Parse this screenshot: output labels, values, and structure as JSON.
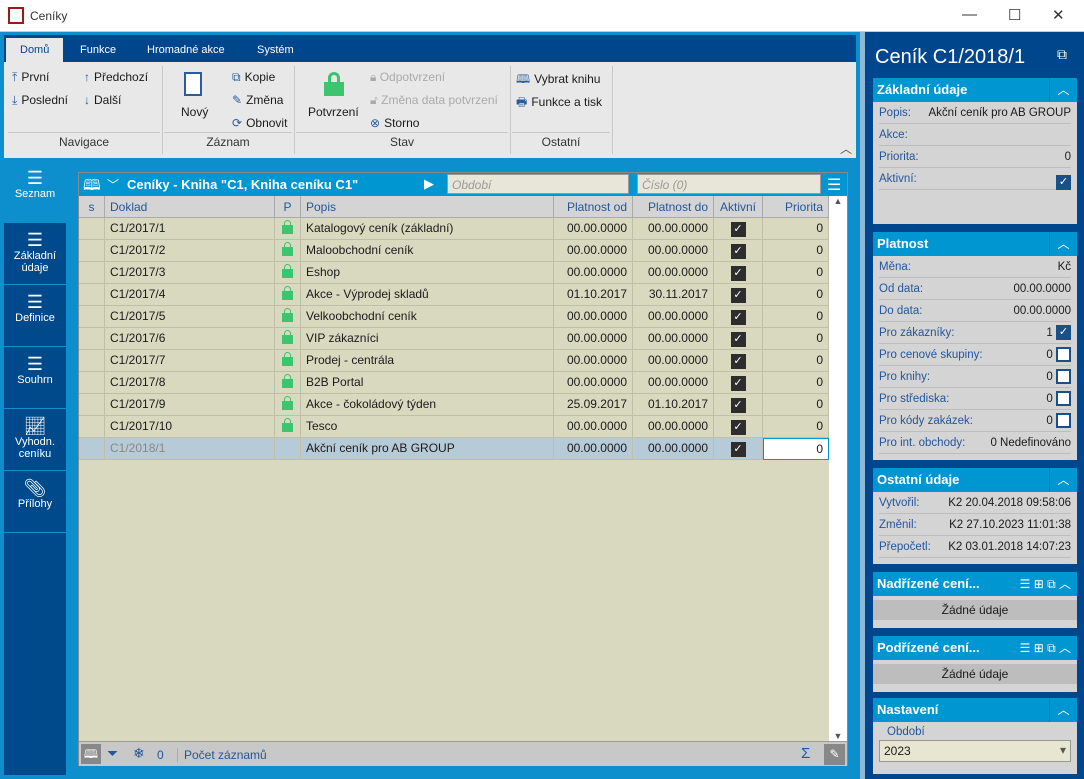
{
  "window": {
    "title": "Ceníky",
    "minimize": "—",
    "maximize": "☐",
    "close": "✕"
  },
  "ribbon": {
    "tabs": [
      "Domů",
      "Funkce",
      "Hromadné akce",
      "Systém"
    ],
    "nav": {
      "first": "První",
      "prev": "Předchozí",
      "last": "Poslední",
      "next": "Další",
      "group": "Navigace"
    },
    "record": {
      "new": "Nový",
      "copy": "Kopie",
      "change": "Změna",
      "refresh": "Obnovit",
      "group": "Záznam"
    },
    "state": {
      "confirm": "Potvrzení",
      "unconfirm": "Odpotvrzení",
      "change_date": "Změna data potvrzení",
      "cancel": "Storno",
      "group": "Stav"
    },
    "other": {
      "book": "Vybrat knihu",
      "print": "Funkce a tisk",
      "group": "Ostatní"
    }
  },
  "sidebar": [
    {
      "label": "Seznam",
      "icon": "list-icon"
    },
    {
      "label": "Základní údaje",
      "icon": "list-icon"
    },
    {
      "label": "Definice",
      "icon": "list-icon"
    },
    {
      "label": "Souhrn",
      "icon": "list-icon"
    },
    {
      "label": "Vyhodn. ceníku",
      "icon": "chart-icon"
    },
    {
      "label": "Přílohy",
      "icon": "paperclip-icon"
    }
  ],
  "grid": {
    "title": "Ceníky - Kniha \"C1, Kniha ceníku C1\"",
    "period_placeholder": "Období",
    "number_placeholder": "Číslo (0)",
    "columns": [
      "s",
      "Doklad",
      "P",
      "Popis",
      "Platnost od",
      "Platnost do",
      "Aktivní",
      "Priorita"
    ],
    "rows": [
      {
        "doklad": "C1/2017/1",
        "locked": true,
        "popis": "Katalogový ceník (základní)",
        "od": "00.00.0000",
        "do": "00.00.0000",
        "aktivni": true,
        "priorita": "0"
      },
      {
        "doklad": "C1/2017/2",
        "locked": true,
        "popis": "Maloobchodní ceník",
        "od": "00.00.0000",
        "do": "00.00.0000",
        "aktivni": true,
        "priorita": "0"
      },
      {
        "doklad": "C1/2017/3",
        "locked": true,
        "popis": "Eshop",
        "od": "00.00.0000",
        "do": "00.00.0000",
        "aktivni": true,
        "priorita": "0"
      },
      {
        "doklad": "C1/2017/4",
        "locked": true,
        "popis": "Akce - Výprodej skladů",
        "od": "01.10.2017",
        "do": "30.11.2017",
        "aktivni": true,
        "priorita": "0"
      },
      {
        "doklad": "C1/2017/5",
        "locked": true,
        "popis": "Velkoobchodní ceník",
        "od": "00.00.0000",
        "do": "00.00.0000",
        "aktivni": true,
        "priorita": "0"
      },
      {
        "doklad": "C1/2017/6",
        "locked": true,
        "popis": "VIP zákazníci",
        "od": "00.00.0000",
        "do": "00.00.0000",
        "aktivni": true,
        "priorita": "0"
      },
      {
        "doklad": "C1/2017/7",
        "locked": true,
        "popis": "Prodej - centrála",
        "od": "00.00.0000",
        "do": "00.00.0000",
        "aktivni": true,
        "priorita": "0"
      },
      {
        "doklad": "C1/2017/8",
        "locked": true,
        "popis": "B2B Portal",
        "od": "00.00.0000",
        "do": "00.00.0000",
        "aktivni": true,
        "priorita": "0"
      },
      {
        "doklad": "C1/2017/9",
        "locked": true,
        "popis": "Akce - čokoládový týden",
        "od": "25.09.2017",
        "do": "01.10.2017",
        "aktivni": true,
        "priorita": "0"
      },
      {
        "doklad": "C1/2017/10",
        "locked": true,
        "popis": "Tesco",
        "od": "00.00.0000",
        "do": "00.00.0000",
        "aktivni": true,
        "priorita": "0"
      },
      {
        "doklad": "C1/2018/1",
        "locked": false,
        "popis": "Akční ceník pro AB GROUP",
        "od": "00.00.0000",
        "do": "00.00.0000",
        "aktivni": true,
        "priorita": "0",
        "selected": true
      }
    ],
    "footer": {
      "count": "0",
      "label": "Počet záznamů",
      "sum": "Σ"
    }
  },
  "detail": {
    "title": "Ceník C1/2018/1",
    "basic": {
      "header": "Základní údaje",
      "popis_l": "Popis:",
      "popis": "Akční ceník pro AB GROUP",
      "akce_l": "Akce:",
      "priorita_l": "Priorita:",
      "priorita": "0",
      "aktivni_l": "Aktivní:",
      "aktivni": true
    },
    "validity": {
      "header": "Platnost",
      "mena_l": "Měna:",
      "mena": "Kč",
      "od_l": "Od data:",
      "od": "00.00.0000",
      "do_l": "Do data:",
      "do": "00.00.0000",
      "zak_l": "Pro zákazníky:",
      "zak": "1",
      "skup_l": "Pro cenové skupiny:",
      "skup": "0",
      "knihy_l": "Pro knihy:",
      "knihy": "0",
      "str_l": "Pro střediska:",
      "str": "0",
      "kody_l": "Pro kódy zakázek:",
      "kody": "0",
      "int_l": "Pro int. obchody:",
      "int": "0 Nedefinováno"
    },
    "other": {
      "header": "Ostatní údaje",
      "vytvoril_l": "Vytvořil:",
      "vytvoril": "K2 20.04.2018 09:58:06",
      "zmenil_l": "Změnil:",
      "zmenil": "K2 27.10.2023 11:01:38",
      "prepocetl_l": "Přepočetl:",
      "prepocetl": "K2 03.01.2018 14:07:23"
    },
    "parent": {
      "header": "Nadřízené cení...",
      "empty": "Žádné údaje"
    },
    "child": {
      "header": "Podřízené cení...",
      "empty": "Žádné údaje"
    },
    "settings": {
      "header": "Nastavení",
      "period_l": "Období",
      "period": "2023"
    }
  }
}
